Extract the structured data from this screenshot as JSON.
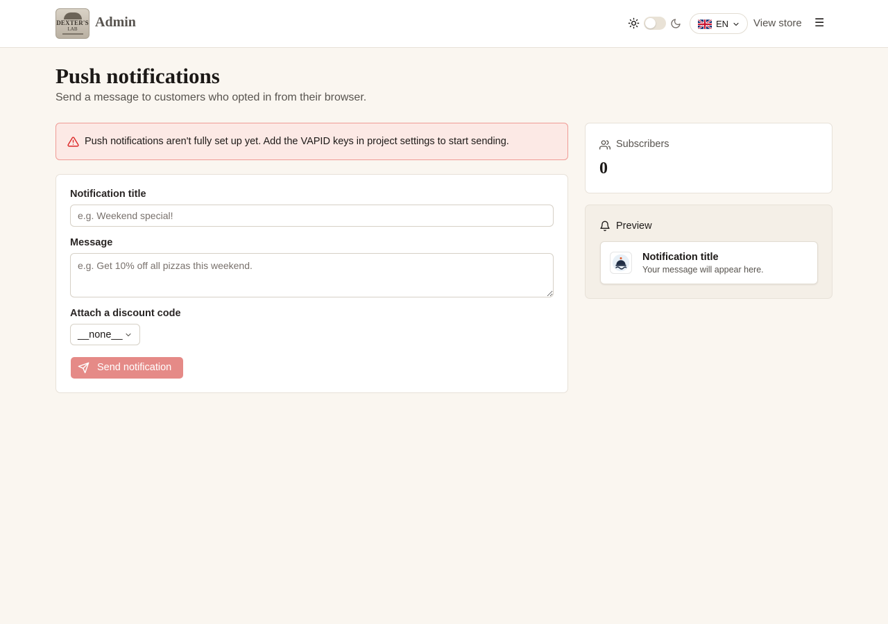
{
  "header": {
    "brand": "Admin",
    "logo_text_top": "DEXTER'S",
    "logo_text_bottom": "LAB",
    "language_code": "EN",
    "view_store_label": "View store",
    "menu_glyph": "☰",
    "icons": {
      "theme_light": "sun-icon",
      "theme_dark": "moon-icon",
      "flag": "uk-flag-icon",
      "language_chevron": "chevron-down-icon",
      "menu": "hamburger-menu-icon"
    }
  },
  "page": {
    "title": "Push notifications",
    "subtitle": "Send a message to customers who opted in from their browser."
  },
  "alert": {
    "text": "Push notifications aren't fully set up yet. Add the VAPID keys in project settings to start sending.",
    "icon": "warning-triangle-icon",
    "color": "#dc2626"
  },
  "form": {
    "title_label": "Notification title",
    "title_placeholder": "e.g. Weekend special!",
    "title_value": "",
    "message_label": "Message",
    "message_placeholder": "e.g. Get 10% off all pizzas this weekend.",
    "message_value": "",
    "discount_label": "Attach a discount code",
    "discount_selected": "__none__",
    "send_label": "Send notification",
    "send_icon": "send-icon",
    "send_color": "#e58a87"
  },
  "subscribers": {
    "label": "Subscribers",
    "count": "0",
    "icon": "users-icon"
  },
  "preview": {
    "label": "Preview",
    "icon": "bell-icon",
    "notification_title": "Notification title",
    "notification_message": "Your message will appear here."
  },
  "colors": {
    "background": "#faf6f0",
    "alert_bg": "#fce9e5",
    "alert_border": "#ef9b95",
    "card_bg": "#ffffff",
    "preview_bg": "#f4efe7"
  }
}
